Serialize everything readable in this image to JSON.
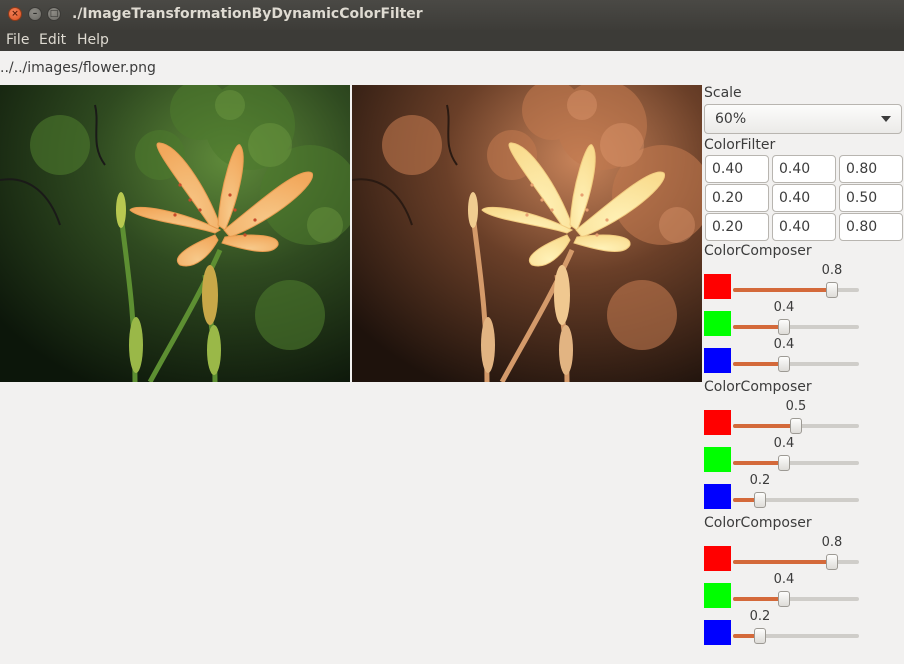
{
  "window": {
    "title": "./ImageTransformationByDynamicColorFilter",
    "buttons": {
      "close": "×",
      "minimize": "–",
      "maximize": "□"
    }
  },
  "menu": [
    "File",
    "Edit",
    "Help"
  ],
  "file_path": "../../images/flower.png",
  "scale": {
    "label": "Scale",
    "value": "60%"
  },
  "color_filter": {
    "label": "ColorFilter",
    "rows": [
      [
        "0.40",
        "0.40",
        "0.80"
      ],
      [
        "0.20",
        "0.40",
        "0.50"
      ],
      [
        "0.20",
        "0.40",
        "0.80"
      ]
    ]
  },
  "composers": [
    {
      "label": "ColorComposer",
      "sliders": [
        {
          "color": "#ff0000",
          "value": "0.8"
        },
        {
          "color": "#00ff00",
          "value": "0.4"
        },
        {
          "color": "#0000ff",
          "value": "0.4"
        }
      ]
    },
    {
      "label": "ColorComposer",
      "sliders": [
        {
          "color": "#ff0000",
          "value": "0.5"
        },
        {
          "color": "#00ff00",
          "value": "0.4"
        },
        {
          "color": "#0000ff",
          "value": "0.2"
        }
      ]
    },
    {
      "label": "ColorComposer",
      "sliders": [
        {
          "color": "#ff0000",
          "value": "0.8"
        },
        {
          "color": "#00ff00",
          "value": "0.4"
        },
        {
          "color": "#0000ff",
          "value": "0.2"
        }
      ]
    }
  ],
  "colors": {
    "accent": "#d4693a",
    "titlebar": "#3c3b37"
  },
  "icons": {
    "dropdown": "triangle-down-icon"
  }
}
